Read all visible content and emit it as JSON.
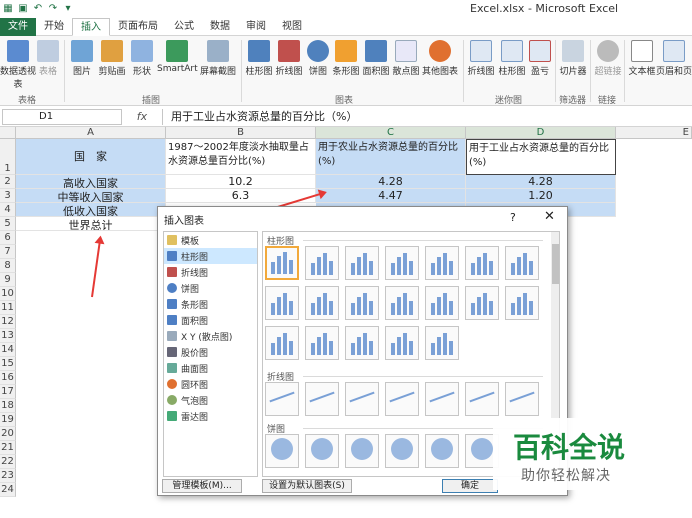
{
  "window": {
    "title": "Excel.xlsx - Microsoft Excel"
  },
  "tabs": [
    "文件",
    "开始",
    "插入",
    "页面布局",
    "公式",
    "数据",
    "审阅",
    "视图"
  ],
  "ribbon": {
    "buttons": [
      "数据透视表",
      "表格",
      "图片",
      "剪贴画",
      "形状",
      "SmartArt",
      "屏幕截图",
      "柱形图",
      "折线图",
      "饼图",
      "条形图",
      "面积图",
      "散点图",
      "其他图表",
      "折线图",
      "柱形图",
      "盈亏",
      "切片器",
      "超链接",
      "文本框",
      "页眉和页脚"
    ],
    "groups": [
      "表格",
      "插图",
      "图表",
      "迷你图",
      "筛选器",
      "链接"
    ]
  },
  "formula_bar": {
    "cell_ref": "D1",
    "fx": "fx",
    "content": "用于工业占水资源总量的百分比（%）"
  },
  "columns": [
    "A",
    "B",
    "C",
    "D",
    "E"
  ],
  "rows": [
    "1",
    "2",
    "3",
    "4",
    "5",
    "6",
    "7",
    "8",
    "9",
    "10",
    "11",
    "12",
    "13",
    "14",
    "15",
    "16",
    "17",
    "18",
    "19",
    "20",
    "21",
    "22",
    "23",
    "24"
  ],
  "cells": {
    "a1": "国　家",
    "b1": "1987～2002年度淡水抽取量占水资源总量百分比(%)",
    "c1": "用于农业占水资源总量的百分比(%)",
    "d1": "用于工业占水资源总量的百分比(%)",
    "a2": "高收入国家",
    "b2": "10.2",
    "c2": "4.28",
    "d2": "4.28",
    "a3": "中等收入国家",
    "b3": "6.3",
    "c3": "4.47",
    "d3": "1.20",
    "a4": "低收入国家",
    "a5": "世界总计"
  },
  "dialog": {
    "title": "插入图表",
    "help": "?",
    "close": "✕",
    "categories": [
      "模板",
      "柱形图",
      "折线图",
      "饼图",
      "条形图",
      "面积图",
      "X Y (散点图)",
      "股价图",
      "曲面图",
      "圆环图",
      "气泡图",
      "雷达图"
    ],
    "sections": [
      "柱形图",
      "折线图",
      "饼图"
    ],
    "manage_button": "管理模板(M)...",
    "default_button": "设置为默认图表(S)",
    "ok_button": "确定"
  },
  "watermark": {
    "line1": "百科全说",
    "line2": "助你轻松解决"
  }
}
